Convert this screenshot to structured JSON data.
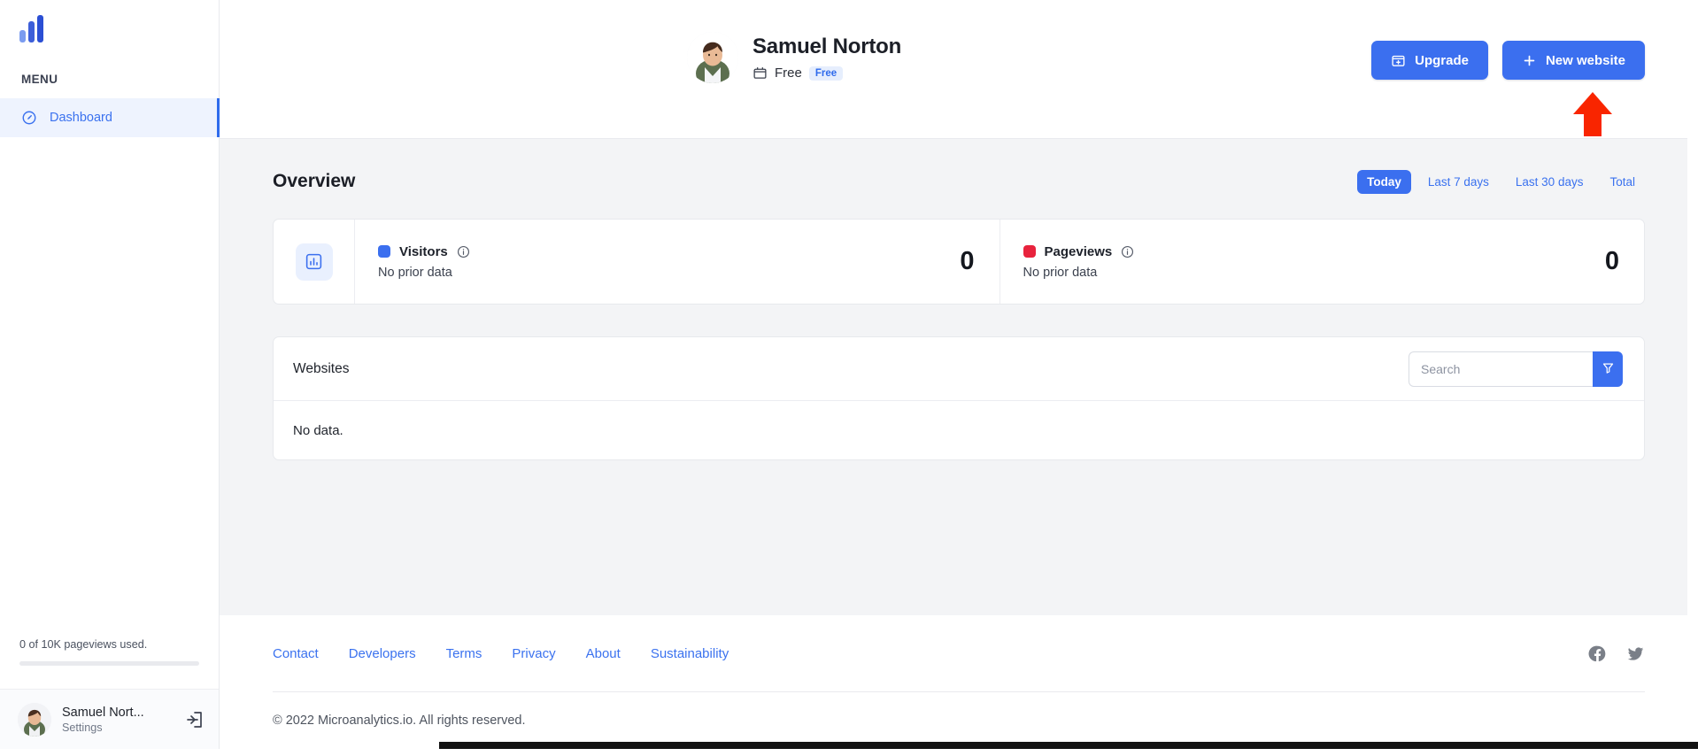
{
  "colors": {
    "accent": "#3b6fef",
    "link": "#3b72ef",
    "visitors_swatch": "#3b6fef",
    "pageviews_swatch": "#e8233d",
    "page_bg": "#f3f4f6",
    "arrow": "#f92500"
  },
  "sidebar": {
    "logo_name": "microanalytics-logo",
    "menu_label": "MENU",
    "items": [
      {
        "label": "Dashboard",
        "icon": "gauge-icon",
        "active": true
      }
    ],
    "usage": {
      "text": "0 of 10K pageviews used.",
      "percent": 0
    },
    "account": {
      "name": "Samuel Nort...",
      "subtitle": "Settings",
      "logout_icon": "logout-icon",
      "avatar_icon": "avatar"
    }
  },
  "header": {
    "profile": {
      "name": "Samuel Norton",
      "plan": "Free",
      "plan_badge": "Free",
      "plan_icon": "box-icon",
      "avatar_icon": "avatar"
    },
    "actions": [
      {
        "label": "Upgrade",
        "icon": "upgrade-box-icon"
      },
      {
        "label": "New website",
        "icon": "plus-icon"
      }
    ],
    "annotation": {
      "name": "red-arrow-pointer",
      "points_to": "New website"
    }
  },
  "overview": {
    "title": "Overview",
    "periods": [
      {
        "label": "Today",
        "active": true
      },
      {
        "label": "Last 7 days",
        "active": false
      },
      {
        "label": "Last 30 days",
        "active": false
      },
      {
        "label": "Total",
        "active": false
      }
    ],
    "card_icon": "bar-chart-icon",
    "stats": [
      {
        "name": "Visitors",
        "sub": "No prior data",
        "value": "0",
        "swatch": "#3b6fef",
        "info_icon": "info-icon"
      },
      {
        "name": "Pageviews",
        "sub": "No prior data",
        "value": "0",
        "swatch": "#e8233d",
        "info_icon": "info-icon"
      }
    ]
  },
  "websites": {
    "title": "Websites",
    "search_placeholder": "Search",
    "search_value": "",
    "filter_icon": "filter-icon",
    "empty_text": "No data."
  },
  "footer": {
    "links": [
      {
        "label": "Contact"
      },
      {
        "label": "Developers"
      },
      {
        "label": "Terms"
      },
      {
        "label": "Privacy"
      },
      {
        "label": "About"
      },
      {
        "label": "Sustainability"
      }
    ],
    "socials": [
      {
        "icon": "facebook-icon"
      },
      {
        "icon": "twitter-icon"
      }
    ],
    "copyright": "© 2022 Microanalytics.io. All rights reserved."
  }
}
